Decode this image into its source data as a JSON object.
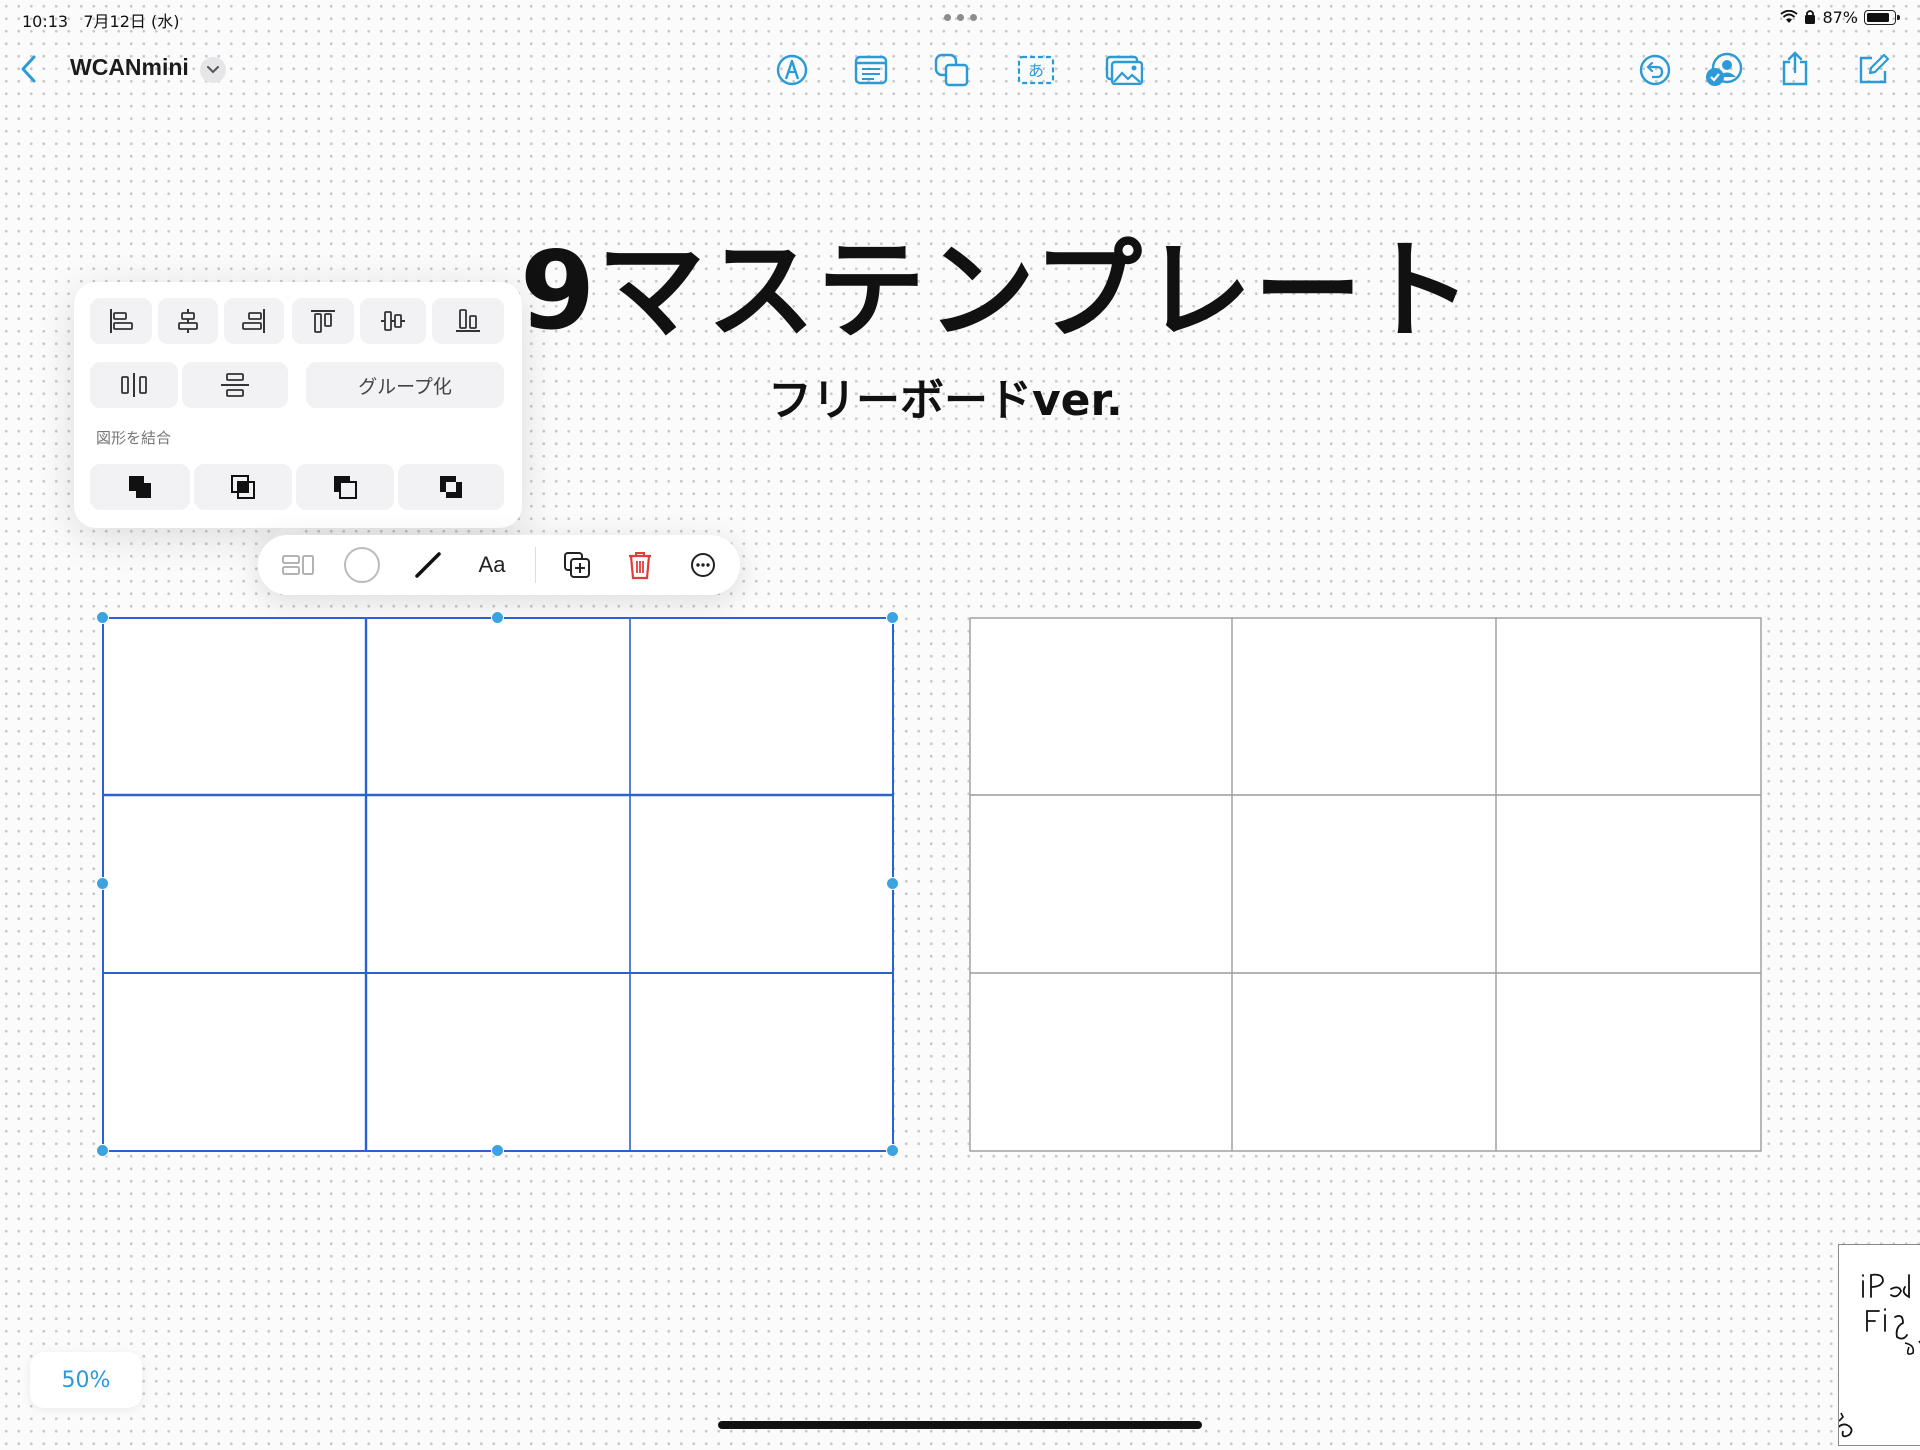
{
  "status_bar": {
    "time": "10:13",
    "date": "7月12日 (水)",
    "battery": "87%",
    "battery_level": 0.87
  },
  "toolbar": {
    "back_icon": "chevron-left-icon",
    "title": "WCANmini",
    "center_tools": [
      "pen-icon",
      "sticky-note-icon",
      "shapes-icon",
      "text-box-icon",
      "media-icon"
    ],
    "right_tools": [
      "undo-icon",
      "collaborate-icon",
      "share-icon",
      "new-board-icon"
    ]
  },
  "board": {
    "headline": "9マステンプレート",
    "subline": "フリーボードver."
  },
  "popover": {
    "group_label": "グループ化",
    "combine_label": "図形を結合"
  },
  "context_bar": {
    "font_label": "Aa"
  },
  "grids": {
    "rows": 3,
    "cols": 3,
    "selected_color": "#2a62cf",
    "plain_color": "#9a9a9a"
  },
  "zoom": "50%",
  "colors": {
    "accent": "#2b9bd8",
    "delete": "#e03c3c"
  }
}
